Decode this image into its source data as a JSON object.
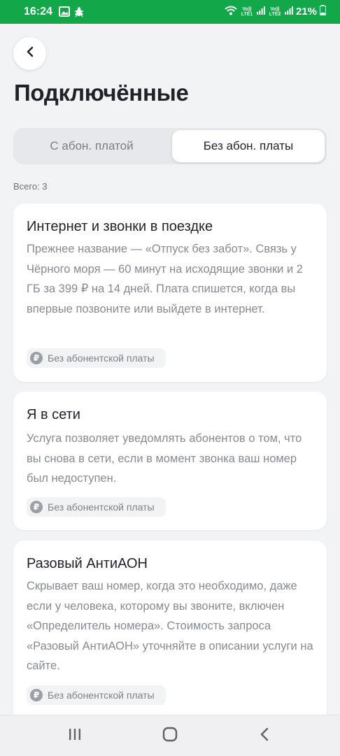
{
  "status_bar": {
    "time": "16:24",
    "left_icons": [
      "image-icon",
      "bug-icon"
    ],
    "right_icons": [
      "wifi-calling-icon",
      "signal-icon",
      "signal-icon",
      "battery-icon"
    ],
    "net_labels": [
      "Vo)) LTE1",
      "Vo)) LTE2"
    ],
    "battery": "21%"
  },
  "header": {
    "back_icon": "chevron-left-icon",
    "title": "Подключённые"
  },
  "tabs": [
    {
      "label": "С абон. платой",
      "selected": false
    },
    {
      "label": "Без абон. платы",
      "selected": true
    }
  ],
  "total_label": "Всего: 3",
  "services": [
    {
      "title": "Интернет и звонки в поездке",
      "description": "Прежнее название — «Отпуск без забот». Связь у Чёрного моря — 60 минут на исходящие звонки и 2 ГБ за 399 ₽ на 14 дней. Плата спишется, когда вы впервые позвоните или выйдете в интернет.",
      "badge": "Без абонентской платы",
      "badge_icon": "ruble-icon"
    },
    {
      "title": "Я в сети",
      "description": "Услуга позволяет уведомлять абонентов о том, что вы снова в сети, если в момент звонка ваш номер был недоступен.",
      "badge": "Без абонентской платы",
      "badge_icon": "ruble-icon"
    },
    {
      "title": "Разовый АнтиАОН",
      "description": "Скрывает ваш номер, когда это необходимо, даже если у человека, которому вы звоните, включен «Определитель номера». Стоимость запроса «Разовый АнтиАОН» уточняйте в описании услуги на сайте.",
      "badge": "Без абонентской платы",
      "badge_icon": "ruble-icon"
    }
  ],
  "nav_bar": {
    "icons": [
      "recents-icon",
      "home-icon",
      "back-icon"
    ]
  },
  "colors": {
    "accent": "#12a84a",
    "background": "#f2f3f5",
    "card": "#ffffff",
    "muted_text": "#868b92"
  }
}
